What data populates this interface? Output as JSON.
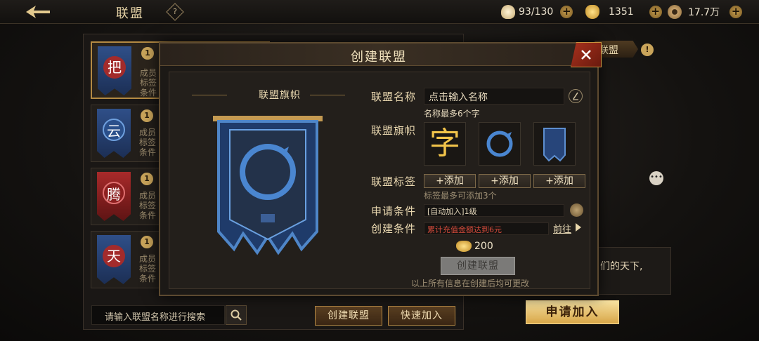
{
  "topbar": {
    "title": "联盟",
    "help": "?",
    "resources": [
      {
        "icon": "food-icon",
        "value": "93/130",
        "color": "#e8d6a6"
      },
      {
        "icon": "gold-ingot-icon",
        "value": "1351",
        "color": "#e4b441"
      },
      {
        "icon": "copper-coin-icon",
        "value": "17.7万",
        "color": "#c8a26c"
      }
    ]
  },
  "alliance_list": [
    {
      "glyph": "把",
      "rank": "1",
      "member_label": "成员",
      "tag_label": "标签",
      "cond_label": "条件",
      "banner_color": "#27457a",
      "ring_color": "#a32b2b",
      "active": true
    },
    {
      "glyph": "云",
      "rank": "1",
      "member_label": "成员",
      "tag_label": "标签",
      "cond_label": "条件",
      "banner_color": "#27457a",
      "ring_color": "#2a4f8a",
      "active": false
    },
    {
      "glyph": "腾",
      "rank": "1",
      "member_label": "成员",
      "tag_label": "标签",
      "cond_label": "条件",
      "banner_color": "#8c1f1f",
      "ring_color": "#8c1f1f",
      "active": false
    },
    {
      "glyph": "天",
      "rank": "1",
      "member_label": "成员",
      "tag_label": "标签",
      "cond_label": "条件",
      "banner_color": "#27457a",
      "ring_color": "#a32b2b",
      "active": false
    }
  ],
  "search": {
    "placeholder": "请输入联盟名称进行搜索"
  },
  "bottom_buttons": {
    "create": "创建联盟",
    "quick_join": "快速加入"
  },
  "right_panel": {
    "tab": "联盟",
    "motto": "们的天下,",
    "apply": "申请加入"
  },
  "modal": {
    "title": "创建联盟",
    "flag_heading": "联盟旗帜",
    "name_label": "联盟名称",
    "name_placeholder": "点击输入名称",
    "name_hint": "名称最多6个字",
    "flag_label": "联盟旗帜",
    "flag_options": [
      "字"
    ],
    "tag_label": "联盟标签",
    "add_buttons": [
      "+添加",
      "+添加",
      "+添加"
    ],
    "tag_hint": "标签最多可添加3个",
    "apply_cond_label": "申请条件",
    "apply_cond_value": "[自动加入]1级",
    "create_cond_label": "创建条件",
    "create_cond_value": "累计充值金额达到6元",
    "goto": "前往",
    "cost": "200",
    "create_button": "创建联盟",
    "footer_note": "以上所有信息在创建后均可更改"
  },
  "colors": {
    "accent_gold": "#c9a45a",
    "banner_blue": "#27457a",
    "warning_red": "#d24a3a"
  }
}
